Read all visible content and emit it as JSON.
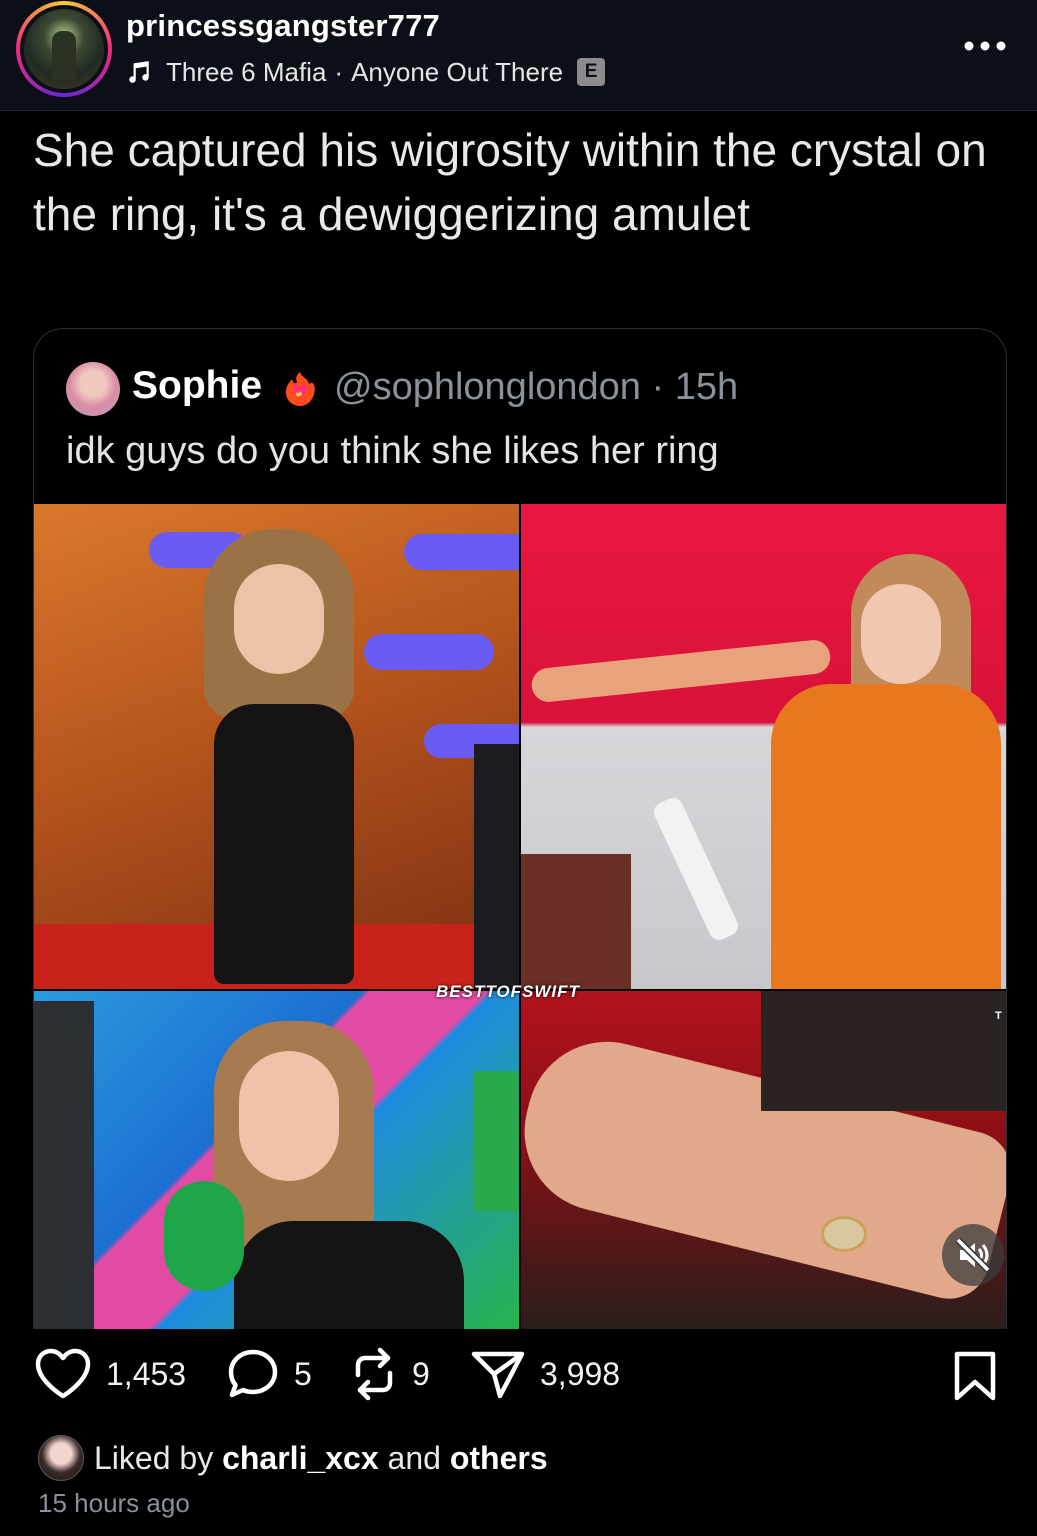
{
  "post": {
    "username": "princessgangster777",
    "music": {
      "artist": "Three 6 Mafia",
      "separator": "·",
      "song": "Anyone Out There",
      "explicit_badge": "E"
    },
    "caption": "She captured his wigrosity within the crystal on the ring, it's a dewiggerizing amulet"
  },
  "quoted": {
    "name": "Sophie",
    "badge_icon": "fire-heart-emoji",
    "handle_time": "@sophlonglondon · 15h",
    "text": "idk guys do you think she likes her ring",
    "watermark": "BESTTOFSWIFT",
    "corner_mark": "T"
  },
  "actions": {
    "likes": "1,453",
    "comments": "5",
    "reposts": "9",
    "shares": "3,998"
  },
  "footer": {
    "liked_prefix": "Liked by",
    "liked_user": "charli_xcx",
    "liked_middle": "and",
    "liked_suffix": "others",
    "time_ago": "15 hours ago"
  },
  "colors": {
    "background": "#000000",
    "header_bg": "#0c0f17",
    "muted_text": "#8b9199",
    "story_ring": [
      "#f9ce34",
      "#ee2a7b",
      "#6228d7"
    ]
  }
}
